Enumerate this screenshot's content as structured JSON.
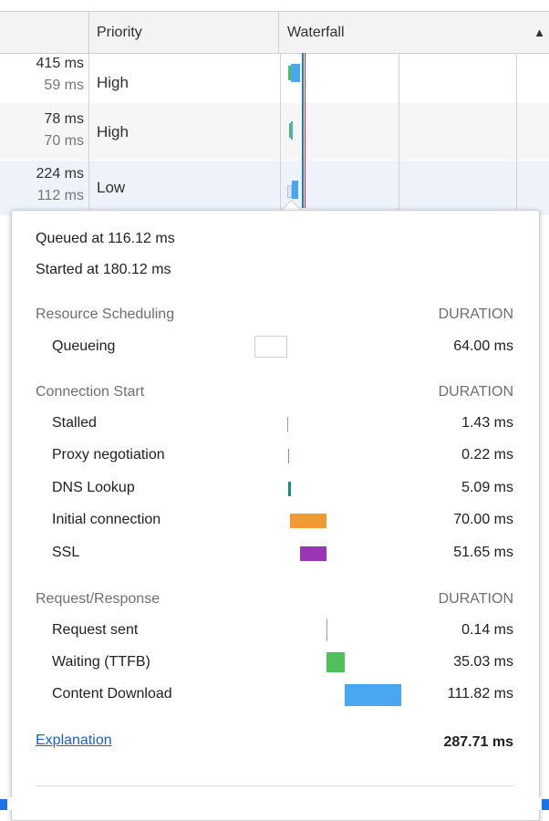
{
  "table": {
    "headers": {
      "size": "",
      "priority": "Priority",
      "waterfall": "Waterfall"
    },
    "rows": [
      {
        "time": "415 ms",
        "latency": "59 ms",
        "priority": "High"
      },
      {
        "time": "78 ms",
        "latency": "70 ms",
        "priority": "High"
      },
      {
        "time": "224 ms",
        "latency": "112 ms",
        "priority": "Low"
      }
    ]
  },
  "timing": {
    "queued_at": "Queued at 116.12 ms",
    "started_at": "Started at 180.12 ms",
    "sections": [
      {
        "title": "Resource Scheduling",
        "duration_header": "DURATION",
        "items": [
          {
            "label": "Queueing",
            "value": "64.00 ms",
            "color": "#ffffff"
          }
        ]
      },
      {
        "title": "Connection Start",
        "duration_header": "DURATION",
        "items": [
          {
            "label": "Stalled",
            "value": "1.43 ms",
            "color": "#9e9e9e"
          },
          {
            "label": "Proxy negotiation",
            "value": "0.22 ms",
            "color": "#b08a6a"
          },
          {
            "label": "DNS Lookup",
            "value": "5.09 ms",
            "color": "#1e8c7e"
          },
          {
            "label": "Initial connection",
            "value": "70.00 ms",
            "color": "#f09a34"
          },
          {
            "label": "SSL",
            "value": "51.65 ms",
            "color": "#9c34b8"
          }
        ]
      },
      {
        "title": "Request/Response",
        "duration_header": "DURATION",
        "items": [
          {
            "label": "Request sent",
            "value": "0.14 ms",
            "color": "#9e9e9e"
          },
          {
            "label": "Waiting (TTFB)",
            "value": "35.03 ms",
            "color": "#4fc05a"
          },
          {
            "label": "Content Download",
            "value": "111.82 ms",
            "color": "#48a7f0"
          }
        ]
      }
    ],
    "explanation_link": "Explanation",
    "total": "287.71 ms"
  }
}
